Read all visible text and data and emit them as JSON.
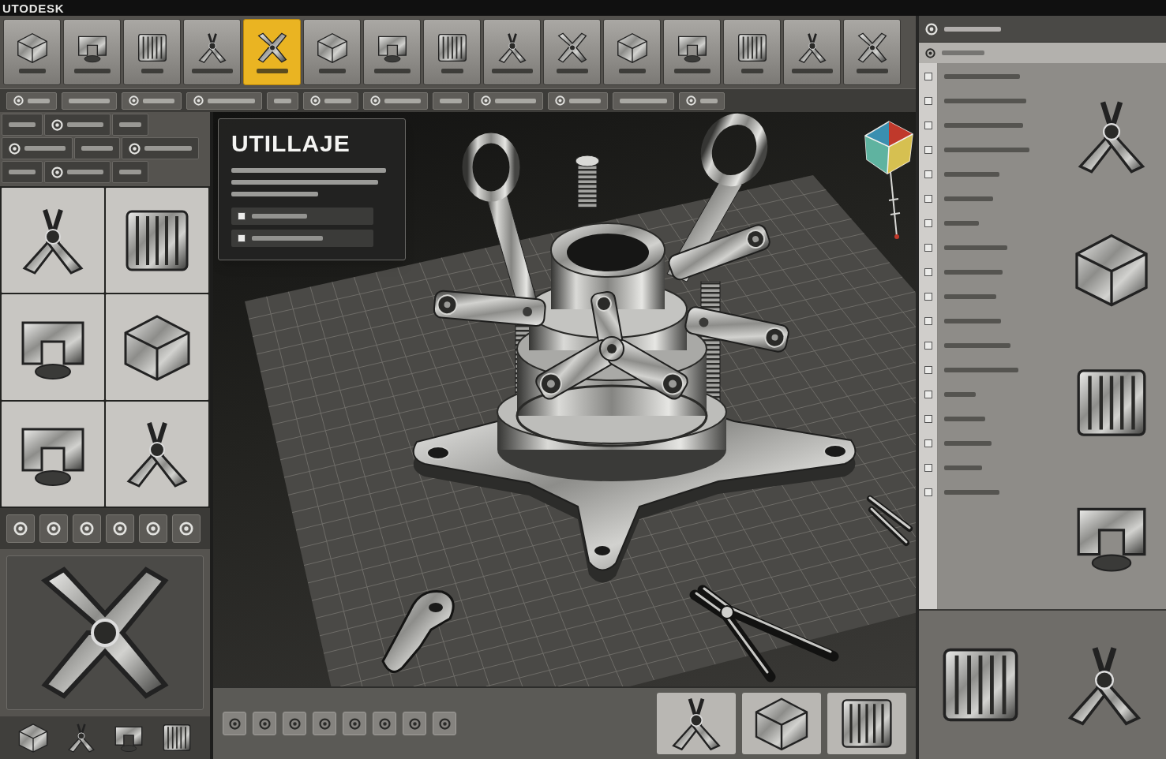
{
  "title_bar": {
    "title": "UTODESK"
  },
  "ribbon": {
    "tools": [
      {
        "selected": false
      },
      {
        "selected": false
      },
      {
        "selected": false
      },
      {
        "selected": false
      },
      {
        "selected": true
      },
      {
        "selected": false
      },
      {
        "selected": false
      },
      {
        "selected": false
      },
      {
        "selected": false
      },
      {
        "selected": false
      },
      {
        "selected": false
      },
      {
        "selected": false
      },
      {
        "selected": false
      },
      {
        "selected": false
      },
      {
        "selected": false
      }
    ]
  },
  "info_card": {
    "title": "UTILLAJE"
  }
}
